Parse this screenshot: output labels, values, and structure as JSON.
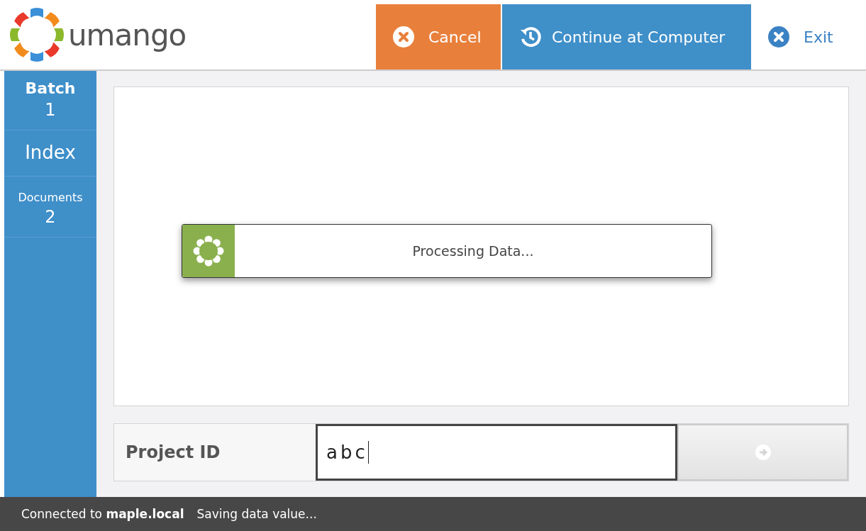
{
  "brand": {
    "name": "umango"
  },
  "toolbar": [
    {
      "kind": "cancel",
      "label": "Cancel"
    },
    {
      "kind": "continue",
      "label": "Continue at Computer"
    },
    {
      "kind": "exit",
      "label": "Exit"
    }
  ],
  "sidebar": {
    "items": [
      {
        "label": "Batch",
        "value": "1"
      },
      {
        "label": "Index"
      },
      {
        "label": "Documents",
        "value": "2"
      }
    ]
  },
  "dialog": {
    "message": "Processing Data..."
  },
  "index_field": {
    "label": "Project ID",
    "value": "abc"
  },
  "status_bar": {
    "connection": "Connected to **maple.local**",
    "message": "Saving data value..."
  }
}
